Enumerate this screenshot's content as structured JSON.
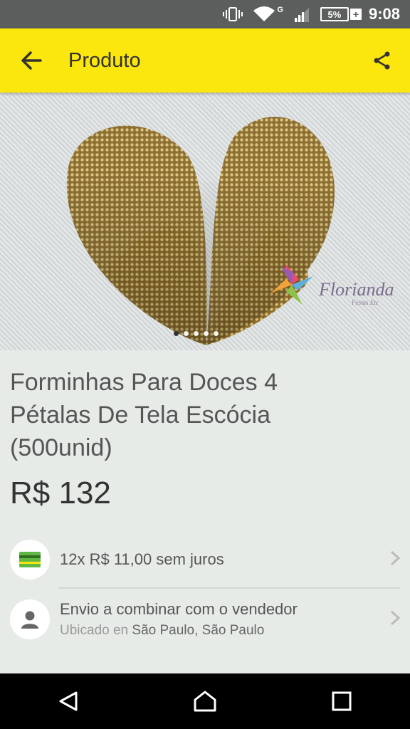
{
  "status_bar": {
    "network_type": "G",
    "battery_percent": "5%",
    "battery_plus": "+",
    "time": "9:08"
  },
  "app_bar": {
    "title": "Produto",
    "background_color": "#fbe60d"
  },
  "gallery": {
    "watermark": "Florianda",
    "watermark_subtitle": "Festas Etc",
    "image_count": 5,
    "active_index": 0
  },
  "product": {
    "title_line1": "Forminhas Para Doces 4",
    "title_line2": "Pétalas De Tela Escócia",
    "title_line3": "(500unid)",
    "price": "R$ 132"
  },
  "payment": {
    "text": "12x R$ 11,00 sem juros",
    "icon": "credit-card-icon",
    "icon_color": "#5fb845"
  },
  "shipping": {
    "text": "Envio a combinar com o vendedor",
    "location_prefix": "Ubicado en",
    "location": "São Paulo, São Paulo",
    "icon": "person-icon"
  },
  "nav": {
    "back": "back-triangle-icon",
    "home": "home-circle-icon",
    "recents": "recents-square-icon"
  }
}
